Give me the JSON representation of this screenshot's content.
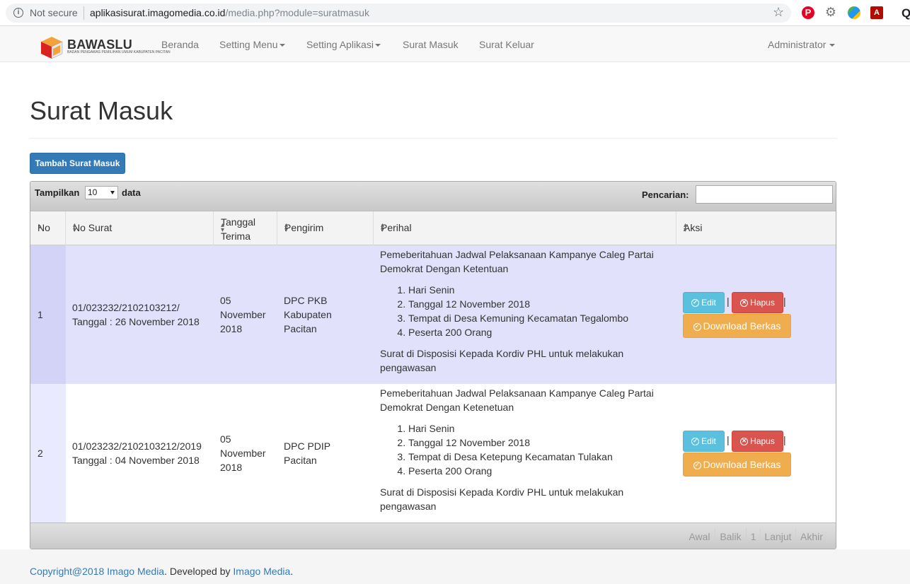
{
  "browser": {
    "security": "Not secure",
    "url_host": "aplikasisurat.imagomedia.co.id",
    "url_path": "/media.php?module=suratmasuk"
  },
  "navbar": {
    "logo_title": "BAWASLU",
    "logo_subtitle": "BADAN PENGAWAS PEMILIHAN UMUM KABUPATEN PACITAN",
    "items": [
      "Beranda",
      "Setting Menu",
      "Setting Aplikasi",
      "Surat Masuk",
      "Surat Keluar"
    ],
    "user": "Administrator"
  },
  "page": {
    "title": "Surat Masuk",
    "add_button": "Tambah Surat Masuk"
  },
  "table_controls": {
    "show_label": "Tampilkan",
    "page_size": "10",
    "data_label": "data",
    "search_label": "Pencarian:",
    "search_value": ""
  },
  "columns": {
    "no": "No",
    "no_surat": "No Surat",
    "tanggal_1": "Tanggal",
    "tanggal_2": "Terima",
    "pengirim": "Pengirim",
    "perihal": "Perihal",
    "aksi": "Aksi"
  },
  "rows": [
    {
      "no": "1",
      "no_surat": "01/023232/2102103212/",
      "tanggal_surat": "Tanggal : 26 November 2018",
      "tgl_1": "05",
      "tgl_2": "November",
      "tgl_3": "2018",
      "pengirim_1": "DPC PKB",
      "pengirim_2": "Kabupaten",
      "pengirim_3": "Pacitan",
      "perihal_intro": "Pemeberitahuan Jadwal Pelaksanaan Kampanye Caleg Partai Demokrat Dengan Ketentuan",
      "perihal_items": [
        "Hari Senin",
        "Tanggal 12 November 2018",
        "Tempat di Desa Kemuning Kecamatan Tegalombo",
        "Peserta 200 Orang"
      ],
      "perihal_note": "Surat di Disposisi Kepada Kordiv PHL untuk melakukan pengawasan"
    },
    {
      "no": "2",
      "no_surat": "01/023232/2102103212/2019",
      "tanggal_surat": "Tanggal : 04 November 2018",
      "tgl_1": "05",
      "tgl_2": "November",
      "tgl_3": "2018",
      "pengirim_1": "DPC PDIP",
      "pengirim_2": "Pacitan",
      "pengirim_3": "",
      "perihal_intro": "Pemeberitahuan Jadwal Pelaksanaan Kampanye Caleg Partai Demokrat Dengan Ketenetuan",
      "perihal_items": [
        "Hari Senin",
        "Tanggal 12 November 2018",
        "Tempat di Desa Ketepung Kecamatan Tulakan",
        "Peserta 200 Orang"
      ],
      "perihal_note": "Surat di Disposisi Kepada Kordiv PHL untuk melakukan pengawasan"
    }
  ],
  "actions": {
    "edit": "Edit",
    "hapus": "Hapus",
    "download": "Download Berkas",
    "separator": "|"
  },
  "pagination": [
    "Awal",
    "Balik",
    "1",
    "Lanjut",
    "Akhir"
  ],
  "footer": {
    "copyright": "Copyright@2018 Imago Media",
    "developed": ". Developed by ",
    "developer": "Imago Media",
    "end": "."
  },
  "colors": {
    "primary": "#337ab7",
    "info": "#5bc0de",
    "danger": "#d9534f",
    "warning": "#f0ad4e",
    "row_highlight": "#e1e1fc"
  }
}
